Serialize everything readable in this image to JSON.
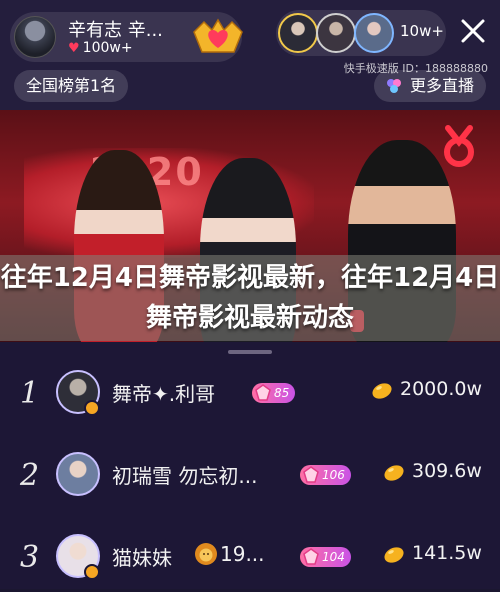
{
  "header": {
    "host_name": "辛有志 辛...",
    "host_fans": "100w+",
    "viewer_count": "10w+",
    "watermark": "快手极速版 ID：188888880",
    "rank_label": "全国榜第1名",
    "more_live_label": "更多直播"
  },
  "stage": {
    "logo_text": "2020"
  },
  "article_title": "往年12月4日舞帝影视最新，往年12月4日舞帝影视最新动态",
  "leaderboard": [
    {
      "rank": "1",
      "name": "舞帝✦.利哥",
      "level": "85",
      "coins": "2000.0w"
    },
    {
      "rank": "2",
      "name": "初瑞雪 勿忘初...",
      "level": "106",
      "coins": "309.6w"
    },
    {
      "rank": "3",
      "name": "猫妹妹",
      "name_suffix": "19...",
      "level": "104",
      "coins": "141.5w"
    }
  ],
  "colors": {
    "accent_gold": "#f1c94a",
    "heart_red": "#ff3b5c",
    "level_pink": "#ff6fa5"
  }
}
